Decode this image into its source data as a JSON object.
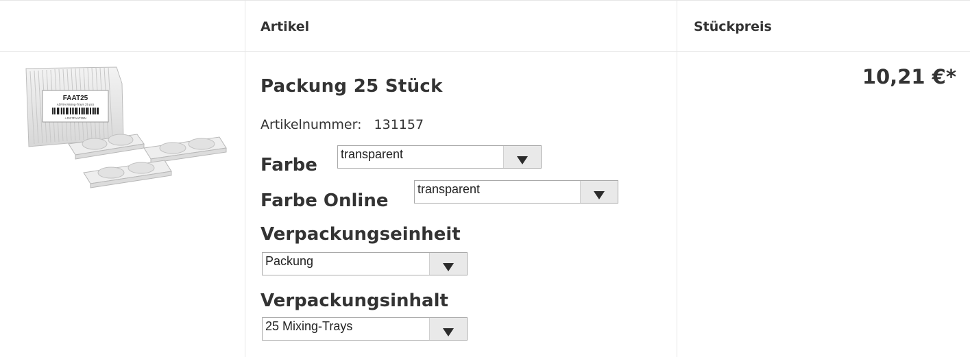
{
  "table": {
    "header_artikel": "Artikel",
    "header_stueckpreis": "Stückpreis"
  },
  "product": {
    "image_label": "FAAT25",
    "image_sublabel": "ADVIA Mixing-Trays 25 pcs",
    "image_barcode_text": "+J017FAAT25N",
    "title": "Packung 25 Stück",
    "artikelnummer_label": "Artikelnummer:",
    "artikelnummer_value": "131157",
    "price": "10,21 €*"
  },
  "options": {
    "farbe_label": "Farbe",
    "farbe_value": "transparent",
    "farbe_online_label": "Farbe Online",
    "farbe_online_value": "transparent",
    "verpackungseinheit_label": "Verpackungseinheit",
    "verpackungseinheit_value": "Packung",
    "verpackungsinhalt_label": "Verpackungsinhalt",
    "verpackungsinhalt_value": "25 Mixing-Trays"
  },
  "icons": {
    "select_arrow": "chevron-down-icon"
  }
}
